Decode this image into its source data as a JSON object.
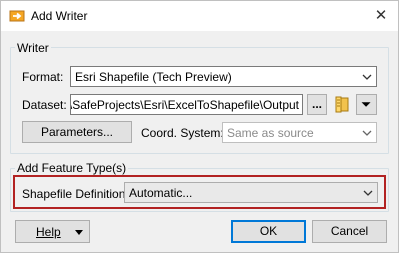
{
  "window": {
    "title": "Add Writer",
    "close_glyph": "✕"
  },
  "writer_group": {
    "title": "Writer",
    "format_label": "Format:",
    "format_value": "Esri Shapefile (Tech Preview)",
    "dataset_label": "Dataset:",
    "dataset_value": "nts\\SafeProjects\\Esri\\ExcelToShapefile\\Output",
    "browse_label": "...",
    "parameters_label": "Parameters...",
    "coord_label": "Coord. System:",
    "coord_value": "Same as source"
  },
  "feature_group": {
    "title": "Add Feature Type(s)",
    "definition_label": "Shapefile Definition:",
    "definition_value": "Automatic..."
  },
  "footer": {
    "help_label": "Help",
    "ok_label": "OK",
    "cancel_label": "Cancel"
  },
  "icons": {
    "app": "writer-app-icon",
    "folder": "folder-icon",
    "dropdown": "chevron-down-icon"
  },
  "colors": {
    "highlight": "#b22222",
    "primary_border": "#0078d7"
  }
}
